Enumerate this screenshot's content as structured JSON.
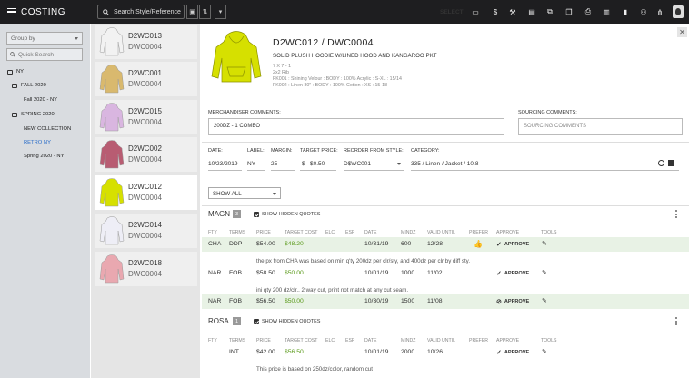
{
  "app": {
    "title": "COSTING"
  },
  "search": {
    "placeholder": "Search Style/Reference"
  },
  "toolbar": {
    "select_label": "SELECT",
    "icons": [
      "folder-icon",
      "dollar-icon",
      "hammer-icon",
      "document-icon",
      "copy-icon",
      "print-icon",
      "trash-icon",
      "bookmark-icon",
      "people-icon",
      "tree-icon",
      "user-icon"
    ]
  },
  "sidebar": {
    "groupby": "Group by",
    "quick_search": "Quick Search",
    "tree": [
      "NY",
      "FALL 2020",
      "Fall 2020 - NY",
      "SPRING 2020",
      "NEW COLLECTION",
      "RETRO NY",
      "Spring 2020 - NY"
    ]
  },
  "styles": [
    {
      "code": "D2WC013",
      "ref": "DWC0004",
      "color": "#f2f2f2"
    },
    {
      "code": "D2WC001",
      "ref": "DWC0004",
      "color": "#d9b96e"
    },
    {
      "code": "D2WC015",
      "ref": "DWC0004",
      "color": "#d9b6e0"
    },
    {
      "code": "D2WC002",
      "ref": "DWC0004",
      "color": "#b85c72"
    },
    {
      "code": "D2WC012",
      "ref": "DWC0004",
      "color": "#d6e000"
    },
    {
      "code": "D2WC014",
      "ref": "DWC0004",
      "color": "#eeeef6"
    },
    {
      "code": "D2WC018",
      "ref": "DWC0004",
      "color": "#e9a8b0"
    }
  ],
  "detail": {
    "title": "D2WC012 / DWC0004",
    "description": "SOLID PLUSH HOODIE W/LINED HOOD AND KANGAROO PKT",
    "specs": [
      "7 X 7 - 1",
      "2x2 Rib",
      "FK001 : Shining Velour : BODY : 100% Acrylic : S-XL : 15/14",
      "FK002 : Linen 80\" : BODY : 100% Cotton : XS : 15-18"
    ],
    "merch_label": "MERCHANDISER COMMENTS:",
    "merch_value": "200DZ - 1 COMBO",
    "sourcing_label": "SOURCING COMMENTS:",
    "sourcing_placeholder": "SOURCING COMMENTS",
    "date_label": "DATE:",
    "date": "10/23/2019",
    "label_label": "LABEL:",
    "label": "NY",
    "margin_label": "MARGIN:",
    "margin": "25",
    "target_label": "TARGET PRICE:",
    "target_currency": "$",
    "target": "$0.50",
    "reorder_label": "REORDER FROM STYLE:",
    "reorder": "D$WC001",
    "category_label": "CATEGORY:",
    "category": "335 / Linen / Jacket / 10.8",
    "show_all": "SHOW ALL"
  },
  "columns": [
    "FTY",
    "TERMS",
    "PRICE",
    "TARGET COST",
    "ELC",
    "ESP",
    "DATE",
    "MINDZ",
    "VALID UNTIL",
    "PREFER",
    "APPROVE",
    "TOOLS"
  ],
  "vendors": [
    {
      "name": "MAGN",
      "count": "3",
      "hidden_label": "SHOW HIDDEN QUOTES",
      "rows": [
        {
          "fty": "CHA",
          "terms": "DDP",
          "price": "$54.00",
          "target": "$48.20",
          "date": "10/31/19",
          "mindz": "600",
          "valid": "12/28",
          "prefer": true,
          "approve": "APPROVE",
          "approved": false,
          "highlight": true,
          "comment": "the px from CHA was based on min q'ty 200dz per clr/sty, and 400dz per clr by diff sty."
        },
        {
          "fty": "NAR",
          "terms": "FOB",
          "price": "$58.50",
          "target": "$50.00",
          "date": "10/01/19",
          "mindz": "1000",
          "valid": "11/02",
          "prefer": false,
          "approve": "APPROVE",
          "approved": false,
          "highlight": false,
          "comment": "ini qty 200 dz/clr.. 2 way cut, print not match at any cut seam."
        },
        {
          "fty": "NAR",
          "terms": "FOB",
          "price": "$56.50",
          "target": "$50.00",
          "date": "10/30/19",
          "mindz": "1500",
          "valid": "11/08",
          "prefer": false,
          "approve": "APPROVE",
          "approved": true,
          "highlight": true,
          "comment": ""
        }
      ]
    },
    {
      "name": "ROSA",
      "count": "1",
      "hidden_label": "SHOW HIDDEN QUOTES",
      "rows": [
        {
          "fty": "",
          "terms": "INT",
          "price": "$42.00",
          "target": "$56.50",
          "date": "10/01/19",
          "mindz": "2000",
          "valid": "10/26",
          "prefer": false,
          "approve": "APPROVE",
          "approved": false,
          "highlight": false,
          "comment": "This price is based on 250dz/color, random cut"
        }
      ]
    }
  ],
  "colors": {
    "topbar": "#1e1e20",
    "highlight": "#e8f2e5",
    "accent": "#2a6dc9",
    "green": "#5a9a1a",
    "hoodie": "#d6e000"
  }
}
